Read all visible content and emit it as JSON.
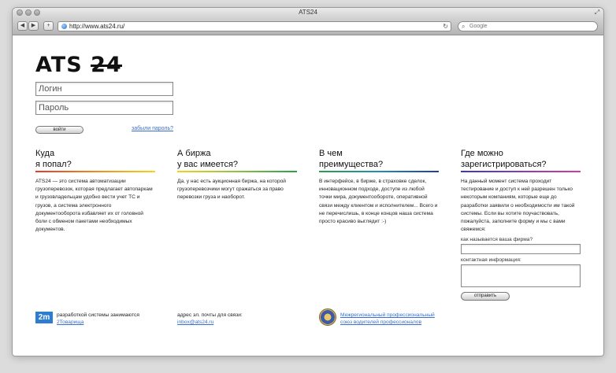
{
  "window": {
    "title": "ATS24"
  },
  "toolbar": {
    "back_icon": "back-arrow-icon",
    "forward_icon": "forward-arrow-icon",
    "add_label": "+",
    "url": "http://www.ats24.ru/",
    "search_placeholder": "Google"
  },
  "logo": {
    "text": "ATS",
    "number": "24"
  },
  "login": {
    "login_placeholder": "Логин",
    "password_placeholder": "Пароль",
    "enter_label": "войти",
    "forgot_label": "забыли пароль?"
  },
  "columns": [
    {
      "heading_line1": "Куда",
      "heading_line2": "я попал?",
      "body": "ATS24 — это система автоматизации грузоперевозок, которая предлагает автопаркам и грузовладельцам удобно вести учет ТС и грузов, а система электронного документооборота избавляет их от головной боли с обменом пакетами необходимых документов.",
      "rule_gradient": "linear-gradient(90deg, #e53a2a, #f08a1c, #f5d21a)"
    },
    {
      "heading_line1": "А биржа",
      "heading_line2": "у вас имеется?",
      "body": "Да, у нас есть аукционная биржа, на которой грузоперевозчики могут сражаться за право перевозки груза и наоборот.",
      "rule_gradient": "linear-gradient(90deg, #f5d21a, #8bc43f, #2aa046)"
    },
    {
      "heading_line1": "В чем",
      "heading_line2": "преимущества?",
      "body": "В интерфейсе, в бирже, в страховке сделок, инновационном подходе, доступе из любой точки мира, документообороте, оперативной связи между клиентом и исполнителем... Всего и не перечислишь, в конце концов наша система просто красиво выглядит :-)",
      "rule_gradient": "linear-gradient(90deg, #2aa046, #1e8fb8, #1f3f9e)"
    },
    {
      "heading_line1": "Где можно",
      "heading_line2": "зарегистрироваться?",
      "body": "На данный момент система проходит тестирование и доступ к ней разрешен только некоторым компаниям, которые еще до разработки заявили о необходимости им такой системы. Если вы хотите поучаствовать, пожалуйста, заполните форму и мы с вами свяжемся:",
      "rule_gradient": "linear-gradient(90deg, #3a3ab8, #8a3ab8, #d63aa0)"
    }
  ],
  "register_form": {
    "company_label": "как называется ваша фирма?",
    "contact_label": "контактная информация:",
    "send_label": "отправить"
  },
  "footer": {
    "dev_logo": "2m",
    "dev_text": "разработкой системы занимаются",
    "dev_link": "2Товарища",
    "email_label": "адрес эл. почты для связи:",
    "email": "inbox@ats24.ru",
    "union_link_line1": "Межрегиональный профессиональный",
    "union_link_line2": "союз водителей профессионалов"
  }
}
